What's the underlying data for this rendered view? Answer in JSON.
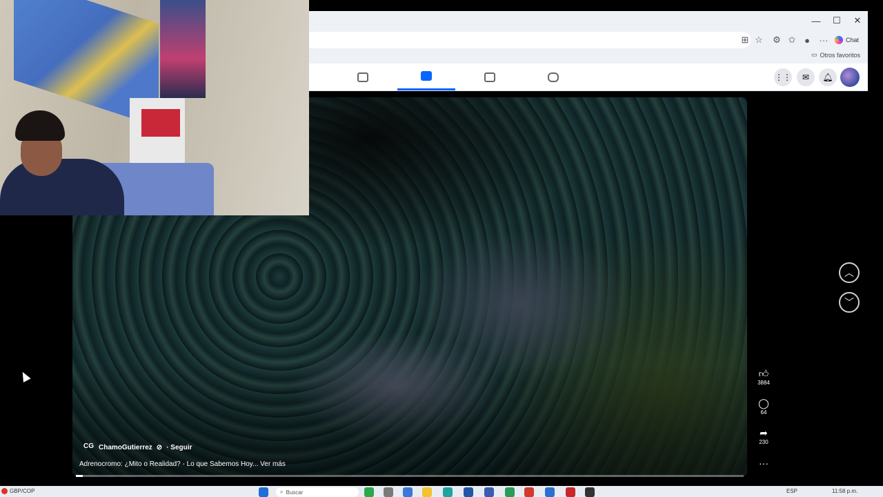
{
  "browser": {
    "window_controls": [
      "—",
      "☐",
      "✕"
    ],
    "chat_label": "Chat",
    "favorites_folder": "Otros favoritos"
  },
  "facebook": {
    "nav_tabs": [
      "home-icon",
      "video-icon",
      "marketplace-icon",
      "gaming-icon"
    ],
    "active_tab": 1
  },
  "video": {
    "channel_name": "ChamoGutierrez",
    "channel_logo": "CG",
    "follow_label": "· Seguir",
    "caption": "Adrenocromo: ¿Mito o Realidad? - Lo que Sabemos Hoy... Ver más",
    "progress": 0.01,
    "actions": {
      "likes": "3884",
      "comments": "64",
      "shares": "230"
    }
  },
  "taskbar": {
    "weather": "GBP/COP",
    "search_placeholder": "Buscar",
    "language": "ESP",
    "time": "11:58 p.m."
  }
}
